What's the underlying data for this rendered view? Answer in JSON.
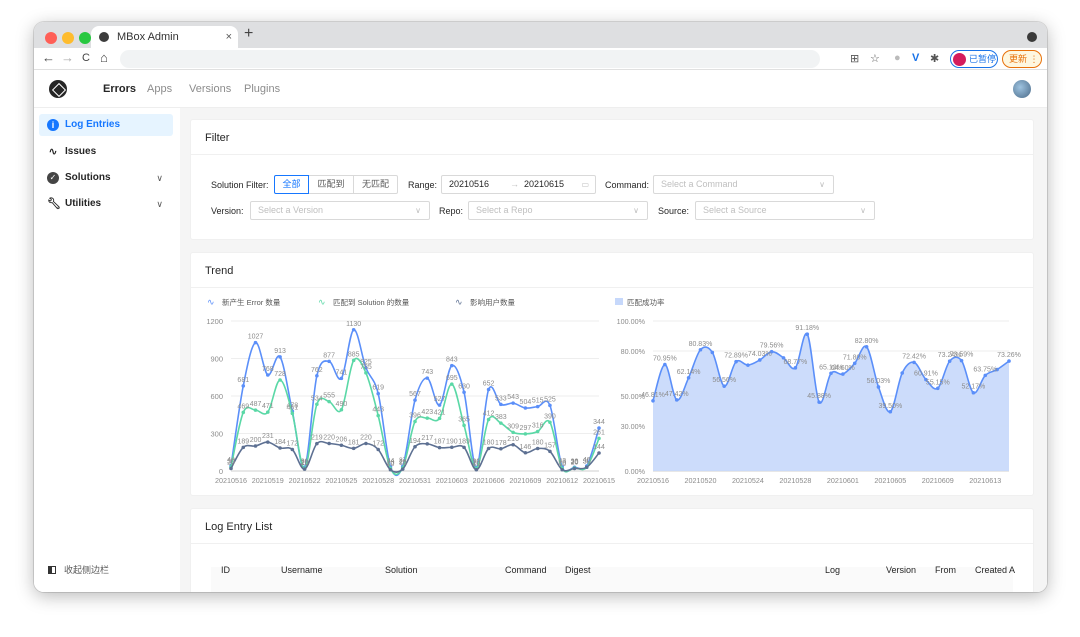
{
  "browser": {
    "tab_title": "MBox Admin",
    "tab_close": "×",
    "new_tab": "+",
    "back": "←",
    "forward": "→",
    "reload": "C",
    "home": "⌂",
    "paused_label": "已暂停",
    "update_label": "更新 ⋮",
    "traffic_colors": [
      "#ff5f57",
      "#febc2e",
      "#28c840"
    ]
  },
  "nav": {
    "items": [
      "Errors",
      "Apps",
      "Versions",
      "Plugins"
    ],
    "active": "Errors"
  },
  "sidebar": {
    "items": [
      {
        "label": "Log Entries",
        "icon": "info-icon",
        "active": true
      },
      {
        "label": "Issues",
        "icon": "pulse-icon"
      },
      {
        "label": "Solutions",
        "icon": "check-circle-icon",
        "chevron": "∨"
      },
      {
        "label": "Utilities",
        "icon": "wrench-icon",
        "chevron": "∨"
      }
    ],
    "collapse_label": "收起侧边栏"
  },
  "filter": {
    "title": "Filter",
    "solution_label": "Solution Filter:",
    "solution_options": [
      "全部",
      "匹配到",
      "无匹配"
    ],
    "solution_selected": "全部",
    "range_label": "Range:",
    "range_start": "20210516",
    "range_end": "20210615",
    "range_arrow": "→",
    "command_label": "Command:",
    "command_placeholder": "Select a Command",
    "version_label": "Version:",
    "version_placeholder": "Select a Version",
    "repo_label": "Repo:",
    "repo_placeholder": "Select a Repo",
    "source_label": "Source:",
    "source_placeholder": "Select a Source"
  },
  "trend": {
    "title": "Trend"
  },
  "chart_data": [
    {
      "type": "line",
      "legend": [
        "新产生 Error 数量",
        "匹配到 Solution 的数量",
        "影响用户数量"
      ],
      "legend_placement": "top-left",
      "x": [
        "20210516",
        "20210517",
        "20210518",
        "20210519",
        "20210520",
        "20210521",
        "20210522",
        "20210523",
        "20210524",
        "20210525",
        "20210526",
        "20210527",
        "20210528",
        "20210529",
        "20210530",
        "20210531",
        "20210601",
        "20210602",
        "20210603",
        "20210604",
        "20210605",
        "20210606",
        "20210607",
        "20210608",
        "20210609",
        "20210610",
        "20210611",
        "20210612",
        "20210613",
        "20210614",
        "20210615"
      ],
      "x_tick_labels": [
        "20210516",
        "20210519",
        "20210522",
        "20210525",
        "20210528",
        "20210531",
        "20210603",
        "20210606",
        "20210609",
        "20210612",
        "20210615"
      ],
      "ylim": [
        0,
        1200
      ],
      "y_ticks": [
        0,
        300,
        600,
        900,
        1200
      ],
      "grid": true,
      "series": [
        {
          "name": "新产生 Error 数量",
          "color": "#5b8ff9",
          "values": [
            40,
            681,
            1027,
            768,
            913,
            478,
            30,
            762,
            877,
            741,
            1130,
            825,
            619,
            34,
            37,
            567,
            743,
            527,
            843,
            630,
            30,
            652,
            533,
            543,
            504,
            515,
            525,
            33,
            30,
            40,
            344
          ]
        },
        {
          "name": "匹配到 Solution 的数量",
          "color": "#5ad8a6",
          "values": [
            30,
            469,
            487,
            471,
            728,
            461,
            20,
            534,
            555,
            490,
            885,
            785,
            443,
            20,
            25,
            396,
            423,
            421,
            695,
            365,
            20,
            412,
            383,
            309,
            297,
            316,
            390,
            20,
            25,
            30,
            261
          ]
        },
        {
          "name": "影响用户数量",
          "color": "#5d7092",
          "values": [
            20,
            189,
            200,
            231,
            184,
            172,
            15,
            219,
            220,
            206,
            181,
            220,
            172,
            10,
            15,
            194,
            217,
            187,
            190,
            189,
            10,
            180,
            178,
            210,
            146,
            180,
            157,
            10,
            20,
            30,
            144
          ]
        }
      ]
    },
    {
      "type": "area",
      "legend": [
        "匹配成功率"
      ],
      "legend_placement": "top-left",
      "x": [
        "20210516",
        "20210517",
        "20210518",
        "20210519",
        "20210520",
        "20210521",
        "20210522",
        "20210523",
        "20210524",
        "20210525",
        "20210526",
        "20210527",
        "20210528",
        "20210529",
        "20210530",
        "20210531",
        "20210601",
        "20210602",
        "20210603",
        "20210604",
        "20210605",
        "20210606",
        "20210607",
        "20210608",
        "20210609",
        "20210610",
        "20210611",
        "20210612",
        "20210613",
        "20210614",
        "20210615"
      ],
      "x_tick_labels": [
        "20210516",
        "20210520",
        "20210524",
        "20210528",
        "20210601",
        "20210605",
        "20210609",
        "20210613"
      ],
      "y_tick_labels": [
        "0.00%",
        "30.00%",
        "50.00%",
        "80.00%",
        "100.00%"
      ],
      "ylim": [
        0,
        100
      ],
      "grid": true,
      "series": [
        {
          "name": "匹配成功率",
          "color": "#5b8ff9",
          "values": [
            46.81,
            70.95,
            47.42,
            62.14,
            80.83,
            79.09,
            56.56,
            72.89,
            70.59,
            74.03,
            79.56,
            75.41,
            68.77,
            91.18,
            45.88,
            65.13,
            64.6,
            71.8,
            82.8,
            56.03,
            39.5,
            65.32,
            72.42,
            60.91,
            55.15,
            73.24,
            73.59,
            52.17,
            63.75,
            67.65,
            73.26
          ]
        }
      ],
      "data_labels": [
        "46.81%",
        "70.95%",
        "47.42%",
        "62.14%",
        "80.83%",
        "56.56%",
        "72.89%",
        "74.03%",
        "79.56%",
        "68.77%",
        "91.18%",
        "45.88%",
        "65.13%",
        "64.60%",
        "71.80%",
        "82.80%",
        "56.03%",
        "39.50%",
        "72.42%",
        "60.91%",
        "55.15%",
        "73.24%",
        "73.59%",
        "52.17%",
        "63.75%",
        "73.26%"
      ]
    }
  ],
  "log_list": {
    "title": "Log Entry List",
    "columns": [
      "ID",
      "Username",
      "Solution",
      "Command",
      "Digest",
      "Log",
      "Version",
      "From",
      "Created A"
    ]
  }
}
